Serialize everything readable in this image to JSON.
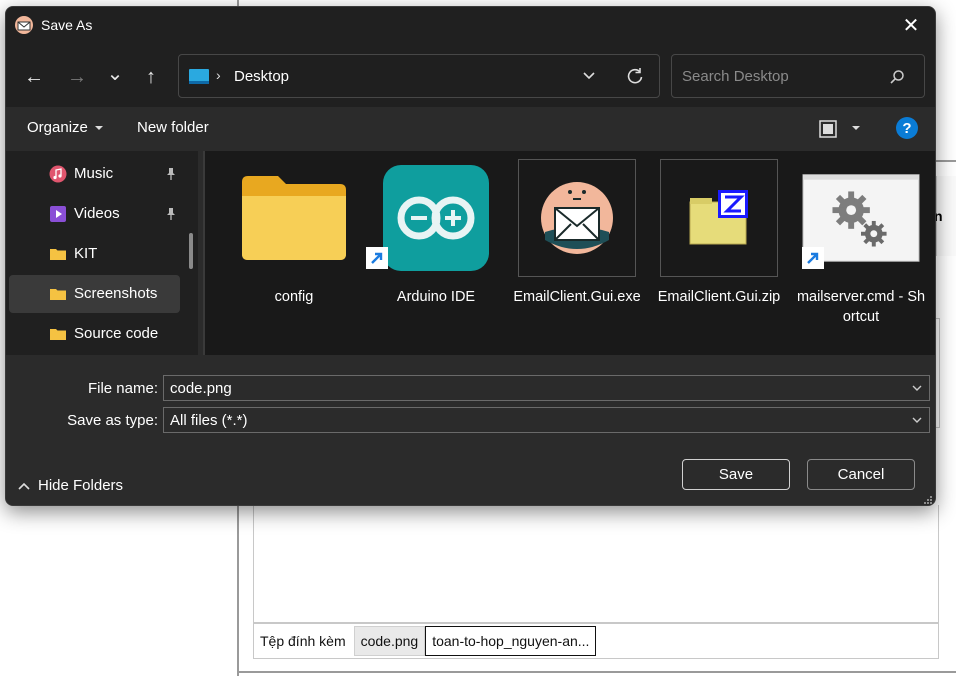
{
  "dialog": {
    "title": "Save As",
    "close_glyph": "✕"
  },
  "nav": {
    "back_glyph": "←",
    "forward_glyph": "→",
    "recent_glyph": "⌄",
    "up_glyph": "↑",
    "address_separator": "›",
    "address_location": "Desktop",
    "search_placeholder": "Search Desktop"
  },
  "commands": {
    "organize": "Organize",
    "new_folder": "New folder",
    "help": "?"
  },
  "sidebar": {
    "items": [
      {
        "label": "Music",
        "icon": "music-icon",
        "pinned": true
      },
      {
        "label": "Videos",
        "icon": "video-icon",
        "pinned": true
      },
      {
        "label": "KIT",
        "icon": "folder-icon",
        "pinned": false
      },
      {
        "label": "Screenshots",
        "icon": "folder-icon",
        "pinned": false,
        "selected": true
      },
      {
        "label": "Source code",
        "icon": "folder-icon",
        "pinned": false
      }
    ]
  },
  "files": [
    {
      "name": "config",
      "type": "folder"
    },
    {
      "name": "Arduino IDE",
      "type": "shortcut"
    },
    {
      "name": "EmailClient.Gui.exe",
      "type": "exe"
    },
    {
      "name": "EmailClient.Gui.zip",
      "type": "zip"
    },
    {
      "name": "mailserver.cmd - Shortcut",
      "type": "shortcut"
    }
  ],
  "form": {
    "file_name_label": "File name:",
    "file_name_value": "code.png",
    "save_type_label": "Save as type:",
    "save_type_value": "All files (*.*)",
    "hide_folders": "Hide Folders",
    "save": "Save",
    "cancel": "Cancel"
  },
  "background_app": {
    "cut_text": "n",
    "attach_label": "Tệp đính kèm",
    "attachments": [
      "code.png",
      "toan-to-hop_nguyen-an..."
    ]
  },
  "colors": {
    "accent": "#0a7cd6",
    "dialog_bg": "#2b2b2b",
    "titlebar_bg": "#202020",
    "content_bg": "#191919",
    "folder_yellow": "#f5c242",
    "arduino_teal": "#0f9e9e"
  }
}
